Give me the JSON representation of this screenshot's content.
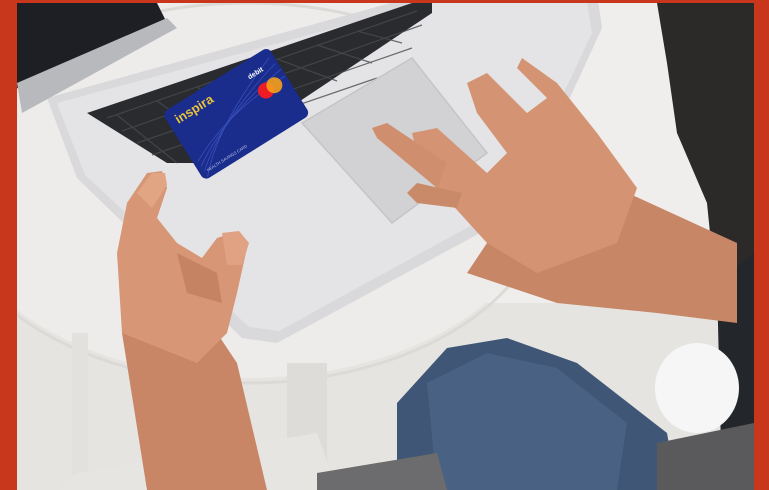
{
  "scene": {
    "frame_color": "#c8361b",
    "background_color": "#f1f0ee"
  },
  "card": {
    "brand": "inspira",
    "type_label": "debit",
    "fine_print": "HEALTH SAVINGS CARD",
    "color": "#1a2c8c",
    "logo_name": "mastercard-logo-icon"
  }
}
